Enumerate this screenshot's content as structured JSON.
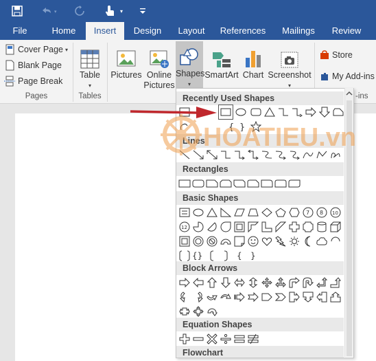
{
  "quick_access": {
    "save_icon": "save-icon",
    "undo_icon": "undo-icon",
    "redo_icon": "redo-icon",
    "touch_icon": "touch-mode-icon",
    "customize_icon": "customize-qat-icon"
  },
  "tabs": [
    "File",
    "Home",
    "Insert",
    "Design",
    "Layout",
    "References",
    "Mailings",
    "Review"
  ],
  "active_tab": "Insert",
  "ribbon": {
    "pages_group": {
      "label": "Pages",
      "cover_page": "Cover Page",
      "blank_page": "Blank Page",
      "page_break": "Page Break"
    },
    "tables_group": {
      "label": "Tables",
      "table": "Table"
    },
    "illustrations": {
      "pictures": "Pictures",
      "online_pictures_1": "Online",
      "online_pictures_2": "Pictures",
      "shapes": "Shapes",
      "smartart": "SmartArt",
      "chart": "Chart",
      "screenshot": "Screenshot"
    },
    "addins": {
      "store": "Store",
      "my_addins": "My Add-ins",
      "label": "-ins"
    }
  },
  "shapes_menu": {
    "sections": [
      {
        "title": "Recently Used Shapes"
      },
      {
        "title": "Lines"
      },
      {
        "title": "Rectangles"
      },
      {
        "title": "Basic Shapes"
      },
      {
        "title": "Block Arrows"
      },
      {
        "title": "Equation Shapes"
      },
      {
        "title": "Flowchart"
      }
    ]
  },
  "watermark": {
    "text": "HOATIEU.vn"
  },
  "colors": {
    "accent": "#2b579a",
    "red_arrow": "#c0282d",
    "watermark_orange": "#f0a050"
  }
}
